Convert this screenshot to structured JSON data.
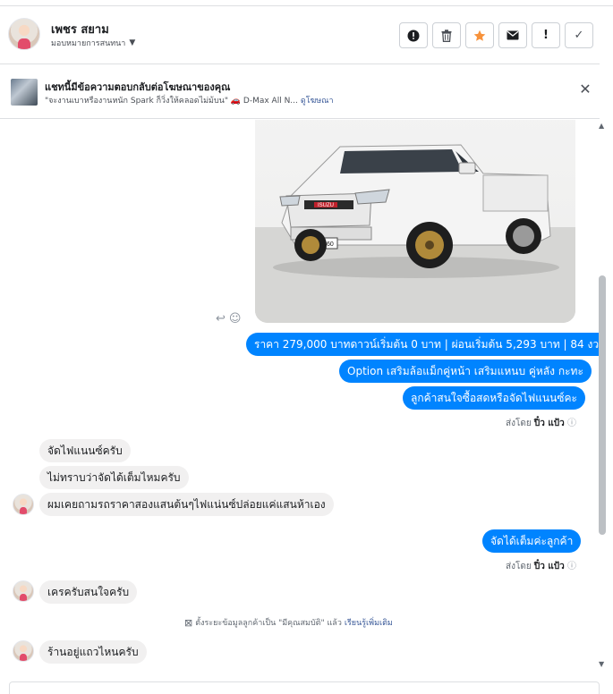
{
  "header": {
    "contact_name": "เพชร สยาม",
    "assign_label": "มอบหมายการสนทนา",
    "actions": [
      {
        "icon": "alert-circle-icon",
        "glyph": "!"
      },
      {
        "icon": "trash-icon",
        "glyph": ""
      },
      {
        "icon": "star-icon",
        "glyph": "★"
      },
      {
        "icon": "envelope-icon",
        "glyph": ""
      },
      {
        "icon": "exclamation-icon",
        "glyph": "!"
      },
      {
        "icon": "check-icon",
        "glyph": "✓"
      }
    ],
    "star_color": "#f7923b"
  },
  "ad_banner": {
    "title": "แชทนี้มีข้อความตอบกลับต่อโฆษณาของคุณ",
    "subtitle": "\"จะงานเบาหรืองานหนัก Spark ก็วิ่งให้คลอดไม่ม้บน\" 🚗 D-Max All N...",
    "link": "ดูโฆษณา"
  },
  "car_photo": {
    "plate": "ยว 5260",
    "brand": "ISUZU"
  },
  "messages": [
    {
      "dir": "out",
      "text": "ราคา 279,000 บาทดาวน์เริ่มต้น 0 บาท | ผ่อนเริ่มต้น 5,293 บาท | 84 งวด"
    },
    {
      "dir": "out",
      "text": "Option เสริมล้อแม็กคู่หน้า เสริมแหนบ คู่หลัง กะทะ"
    },
    {
      "dir": "out",
      "text": "ลูกค้าสนใจซื้อสดหรือจัดไฟแนนซ์คะ"
    },
    {
      "dir": "in",
      "text": "จัดไฟแนนซ์ครับ"
    },
    {
      "dir": "in",
      "text": "ไม่ทราบว่าจัดได้เต็มไหมครับ"
    },
    {
      "dir": "in",
      "text": "ผมเคยถามรถราคาสองแสนต้นๆไฟแน่นซ์ปล่อยแค่แสนห้าเอง"
    },
    {
      "dir": "out",
      "text": "จัดได้เต็มค่ะลูกค้า"
    },
    {
      "dir": "in",
      "text": "เครครับสนใจครับ"
    },
    {
      "dir": "in",
      "text": "ร้านอยู่แถวไหนครับ"
    }
  ],
  "sent_by": {
    "prefix": "ส่งโดย",
    "name": "ปิ๋ว แป้ว"
  },
  "system_message": {
    "text": "ตั้งระยะข้อมูลลูกค้าเป็น \"มีคุณสมบัติ\" แล้ว",
    "link": "เรียนรู้เพิ่มเติม"
  },
  "colors": {
    "outgoing": "#0084ff",
    "incoming": "#f1f0f0",
    "link": "#385898"
  }
}
